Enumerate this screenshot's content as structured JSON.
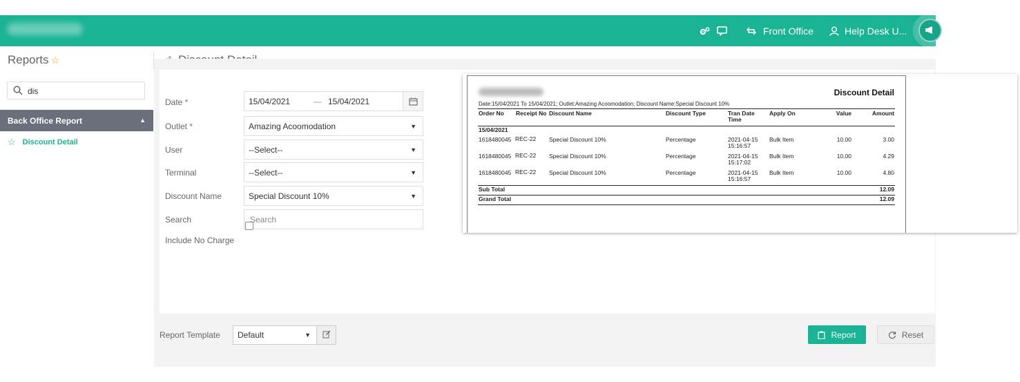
{
  "topbar": {
    "front_office": "Front Office",
    "help_desk": "Help Desk U...",
    "colors": {
      "primary": "#1ab394",
      "section_header": "#6b6f7b"
    },
    "icons": [
      "settings-icon",
      "chat-icon",
      "switch-arrows-icon",
      "user-icon",
      "megaphone-icon"
    ]
  },
  "sidebar": {
    "title": "Reports",
    "search_value": "dis",
    "section": "Back Office Report",
    "items": [
      {
        "label": "Discount Detail"
      }
    ]
  },
  "main": {
    "title": "Discount Detail",
    "form": {
      "date_label": "Date",
      "date_from": "15/04/2021",
      "date_to": "15/04/2021",
      "outlet_label": "Outlet",
      "outlet_value": "Amazing Acoomodation",
      "user_label": "User",
      "user_value": "--Select--",
      "terminal_label": "Terminal",
      "terminal_value": "--Select--",
      "discount_name_label": "Discount Name",
      "discount_name_value": "Special Discount 10%",
      "search_label": "Search",
      "search_placeholder": "Search",
      "include_no_charge_label": "Include No Charge",
      "required_mark": "*",
      "dash": "—"
    },
    "footer": {
      "template_label": "Report Template",
      "template_value": "Default",
      "report_button": "Report",
      "reset_button": "Reset"
    }
  },
  "report": {
    "title": "Discount Detail",
    "filter_line": "Date:15/04/2021 To 15/04/2021; Outlet:Amazing Acoomodation; Discount Name:Special Discount 10%",
    "columns": {
      "order_no": "Order No",
      "receipt_no": "Receipt No",
      "discount_name": "Discount Name",
      "discount_type": "Discount Type",
      "tran_date_1": "Tran Date",
      "tran_date_2": "Time",
      "apply_on": "Apply On",
      "value": "Value",
      "amount": "Amount"
    },
    "group_date": "15/04/2021",
    "rows": [
      {
        "order": "1618480045",
        "receipt": "REC-22",
        "name": "Special Discount 10%",
        "type": "Percentage",
        "date": "2021-04-15",
        "time": "15:16:57",
        "apply": "Bulk Item",
        "value": "10.00",
        "amount": "3.00"
      },
      {
        "order": "1618480045",
        "receipt": "REC-22",
        "name": "Special Discount 10%",
        "type": "Percentage",
        "date": "2021-04-15",
        "time": "15:17:02",
        "apply": "Bulk Item",
        "value": "10.00",
        "amount": "4.29"
      },
      {
        "order": "1618480045",
        "receipt": "REC-22",
        "name": "Special Discount 10%",
        "type": "Percentage",
        "date": "2021-04-15",
        "time": "15:16:57",
        "apply": "Bulk Item",
        "value": "10.00",
        "amount": "4.80"
      }
    ],
    "sub_total_label": "Sub Total",
    "sub_total": "12.09",
    "grand_total_label": "Grand Total",
    "grand_total": "12.09"
  }
}
